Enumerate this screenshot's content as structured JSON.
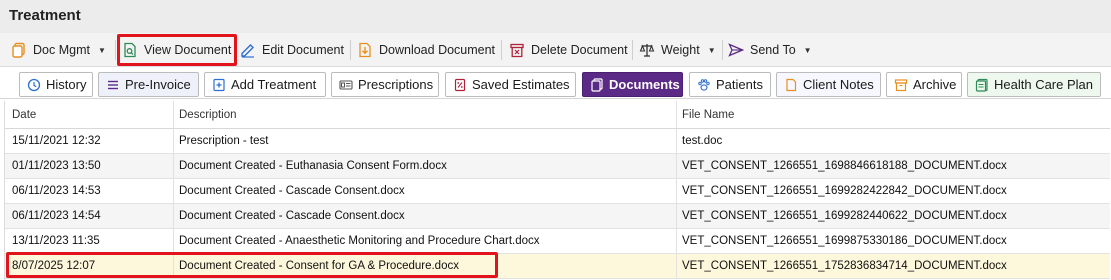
{
  "window": {
    "title": "Treatment"
  },
  "toolbar": {
    "doc_mgmt": "Doc Mgmt",
    "view_document": "View Document",
    "edit_document": "Edit Document",
    "download_document": "Download Document",
    "delete_document": "Delete Document",
    "weight": "Weight",
    "send_to": "Send To"
  },
  "tabs": [
    {
      "label": "History",
      "icon": "history-icon"
    },
    {
      "label": "Pre-Invoice",
      "icon": "list-icon"
    },
    {
      "label": "Add Treatment",
      "icon": "add-document-icon"
    },
    {
      "label": "Prescriptions",
      "icon": "prescription-icon"
    },
    {
      "label": "Saved Estimates",
      "icon": "estimate-icon"
    },
    {
      "label": "Documents",
      "icon": "documents-icon",
      "active": true
    },
    {
      "label": "Patients",
      "icon": "paw-icon"
    },
    {
      "label": "Client Notes",
      "icon": "note-icon"
    },
    {
      "label": "Archive",
      "icon": "archive-icon"
    },
    {
      "label": "Health Care Plan",
      "icon": "health-plan-icon"
    }
  ],
  "table": {
    "columns": [
      "Date",
      "Description",
      "File Name"
    ],
    "rows": [
      {
        "date": "15/11/2021 12:32",
        "description": "Prescription - test",
        "file": "test.doc"
      },
      {
        "date": "01/11/2023 13:50",
        "description": "Document Created - Euthanasia Consent Form.docx",
        "file": "VET_CONSENT_1266551_1698846618188_DOCUMENT.docx"
      },
      {
        "date": "06/11/2023 14:53",
        "description": "Document Created - Cascade Consent.docx",
        "file": "VET_CONSENT_1266551_1699282422842_DOCUMENT.docx"
      },
      {
        "date": "06/11/2023 14:54",
        "description": "Document Created - Cascade Consent.docx",
        "file": "VET_CONSENT_1266551_1699282440622_DOCUMENT.docx"
      },
      {
        "date": "13/11/2023 11:35",
        "description": "Document Created - Anaesthetic Monitoring and Procedure Chart.docx",
        "file": "VET_CONSENT_1266551_1699875330186_DOCUMENT.docx"
      },
      {
        "date": "8/07/2025 12:07",
        "description": "Document Created - Consent for GA & Procedure.docx",
        "file": "VET_CONSENT_1266551_1752836834714_DOCUMENT.docx",
        "selected": true
      }
    ]
  },
  "colors": {
    "active_tab": "#5b2a86",
    "highlight": "#e0141a",
    "selected_row": "#fdf7dc",
    "accent_orange": "#e8901f"
  }
}
